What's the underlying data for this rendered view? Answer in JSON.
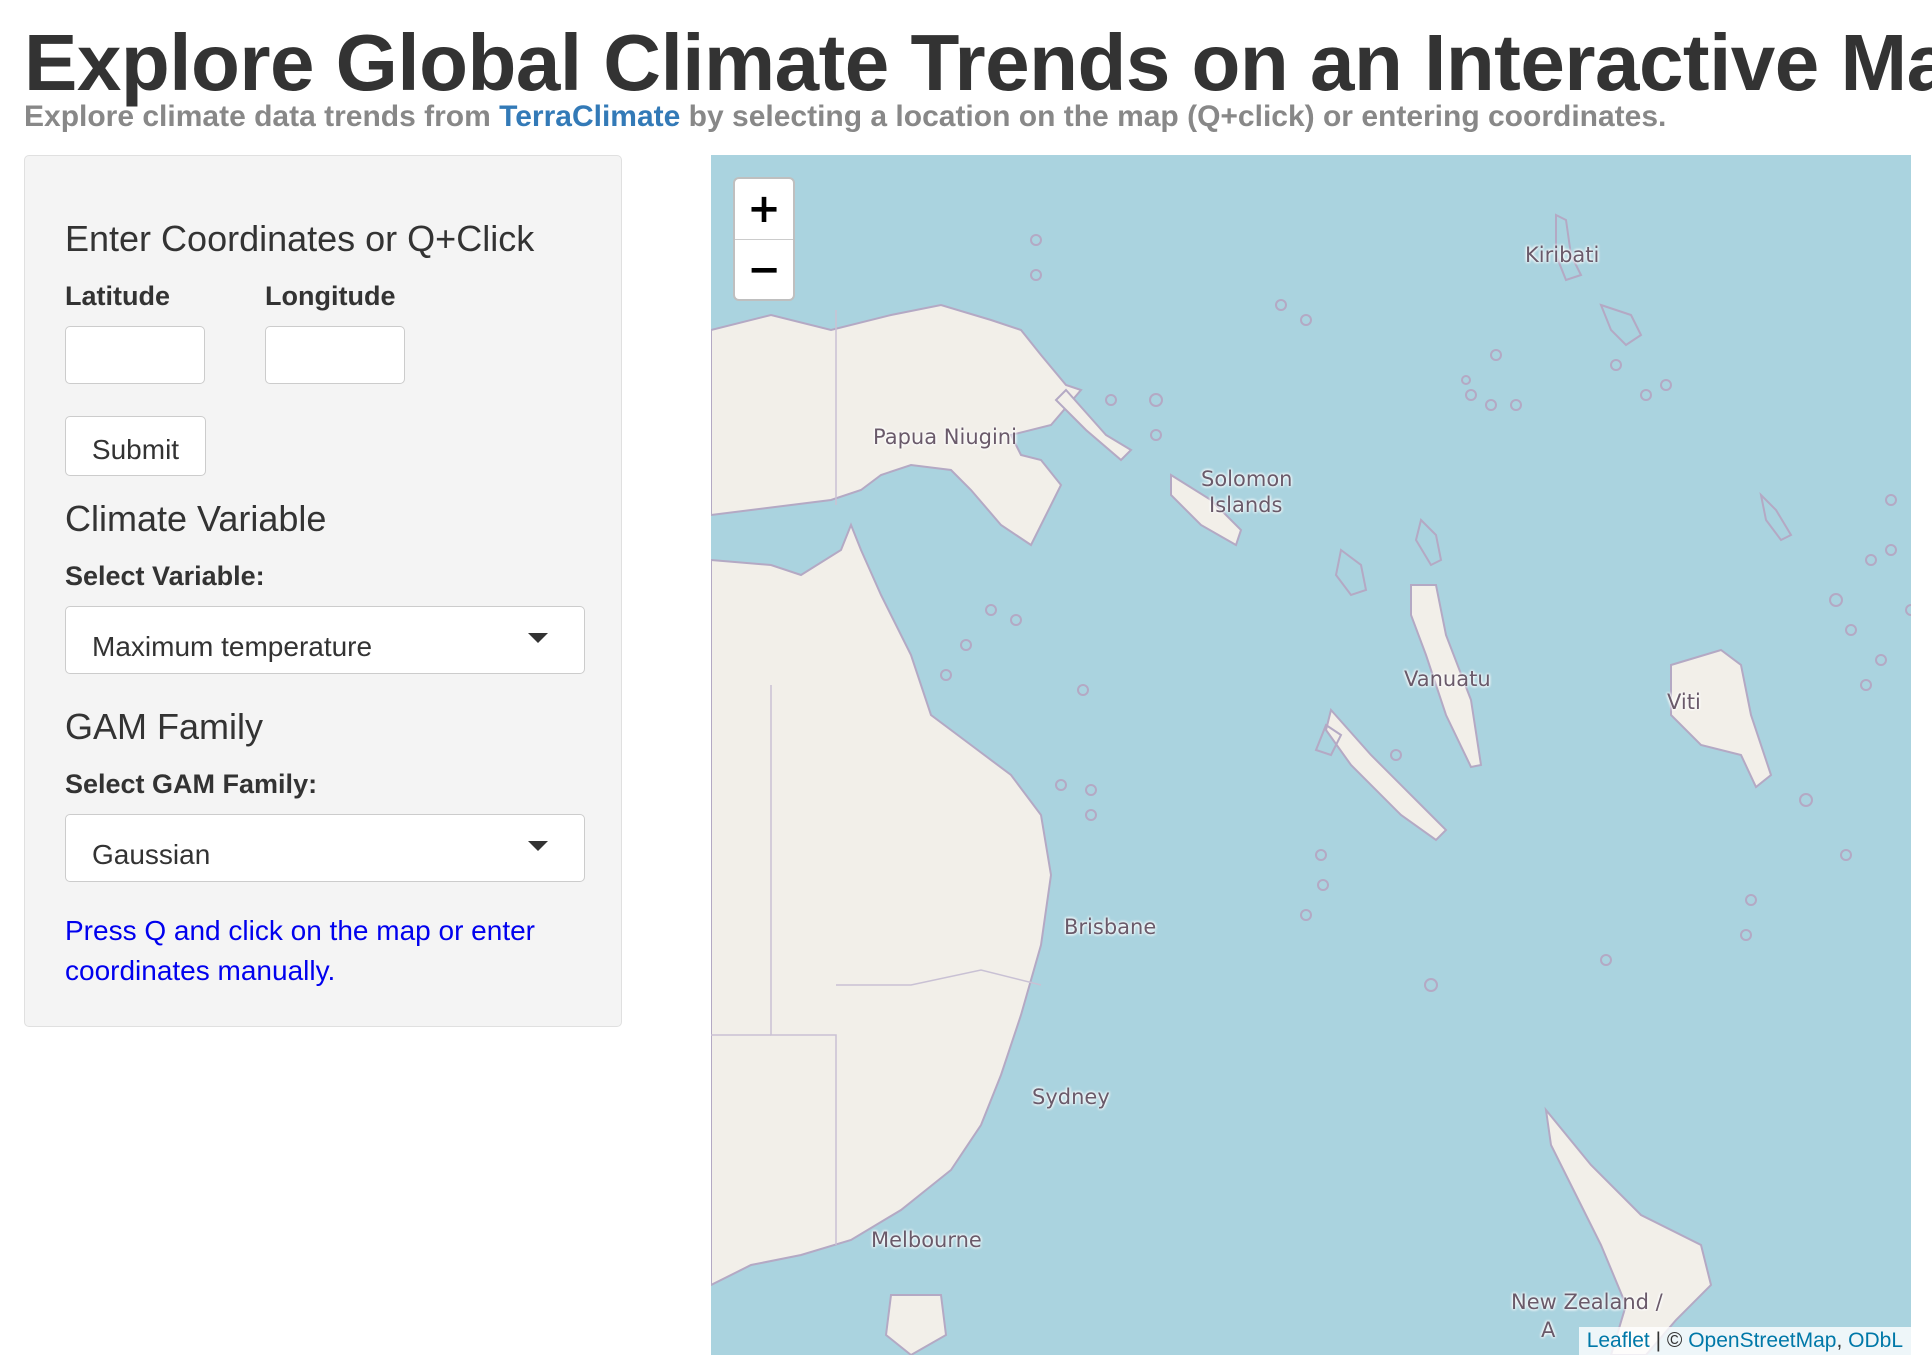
{
  "header": {
    "title": "Explore Global Climate Trends on an Interactive Map",
    "subtitle_before": "Explore climate data trends from ",
    "subtitle_link": "TerraClimate",
    "subtitle_after": " by selecting a location on the map (Q+click) or entering coordinates."
  },
  "sidebar": {
    "coords_heading": "Enter Coordinates or Q+Click",
    "latitude_label": "Latitude",
    "longitude_label": "Longitude",
    "latitude_value": "",
    "longitude_value": "",
    "submit_label": "Submit",
    "variable_heading": "Climate Variable",
    "variable_label": "Select Variable:",
    "variable_selected": "Maximum temperature",
    "family_heading": "GAM Family",
    "family_label": "Select GAM Family:",
    "family_selected": "Gaussian",
    "hint": "Press Q and click on the map or enter coordinates manually."
  },
  "map": {
    "zoom_in": "+",
    "zoom_out": "−",
    "ocean_color": "#aad3df",
    "land_color": "#f2efe9",
    "labels": {
      "kiribati": "Kiribati",
      "papua": "Papua Niugini",
      "solomon1": "Solomon",
      "solomon2": "Islands",
      "vanuatu": "Vanuatu",
      "viti": "Viti",
      "brisbane": "Brisbane",
      "sydney": "Sydney",
      "melbourne": "Melbourne",
      "new_zealand": "New Zealand /",
      "nz_cut": "A"
    },
    "attribution": {
      "leaflet": "Leaflet",
      "sep": " | © ",
      "osm": "OpenStreetMap",
      "comma": ", ",
      "odbl": "ODbL"
    }
  }
}
